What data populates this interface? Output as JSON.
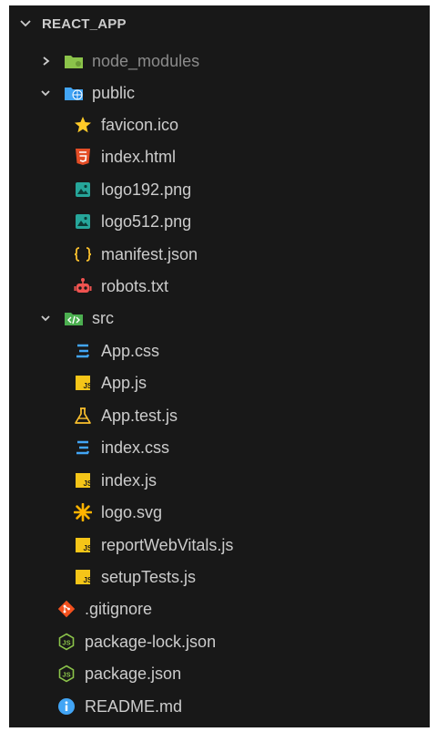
{
  "explorer": {
    "root_label": "REACT_APP",
    "items": [
      {
        "label": "node_modules",
        "icon": "folder-icon"
      },
      {
        "label": "public",
        "icon": "folder-public-icon"
      },
      {
        "label": "favicon.ico",
        "icon": "star-icon"
      },
      {
        "label": "index.html",
        "icon": "html5-icon"
      },
      {
        "label": "logo192.png",
        "icon": "image-icon"
      },
      {
        "label": "logo512.png",
        "icon": "image-icon"
      },
      {
        "label": "manifest.json",
        "icon": "json-braces-icon"
      },
      {
        "label": "robots.txt",
        "icon": "robot-icon"
      },
      {
        "label": "src",
        "icon": "folder-src-icon"
      },
      {
        "label": "App.css",
        "icon": "css-icon"
      },
      {
        "label": "App.js",
        "icon": "js-icon"
      },
      {
        "label": "App.test.js",
        "icon": "test-flask-icon"
      },
      {
        "label": "index.css",
        "icon": "css-icon"
      },
      {
        "label": "index.js",
        "icon": "js-icon"
      },
      {
        "label": "logo.svg",
        "icon": "svg-asterisk-icon"
      },
      {
        "label": "reportWebVitals.js",
        "icon": "js-icon"
      },
      {
        "label": "setupTests.js",
        "icon": "js-icon"
      },
      {
        "label": ".gitignore",
        "icon": "git-icon"
      },
      {
        "label": "package-lock.json",
        "icon": "nodejs-icon"
      },
      {
        "label": "package.json",
        "icon": "nodejs-icon"
      },
      {
        "label": "README.md",
        "icon": "info-icon"
      }
    ]
  },
  "colors": {
    "background": "#181818",
    "text": "#cccccc",
    "dim_text": "#8b8b8b"
  }
}
